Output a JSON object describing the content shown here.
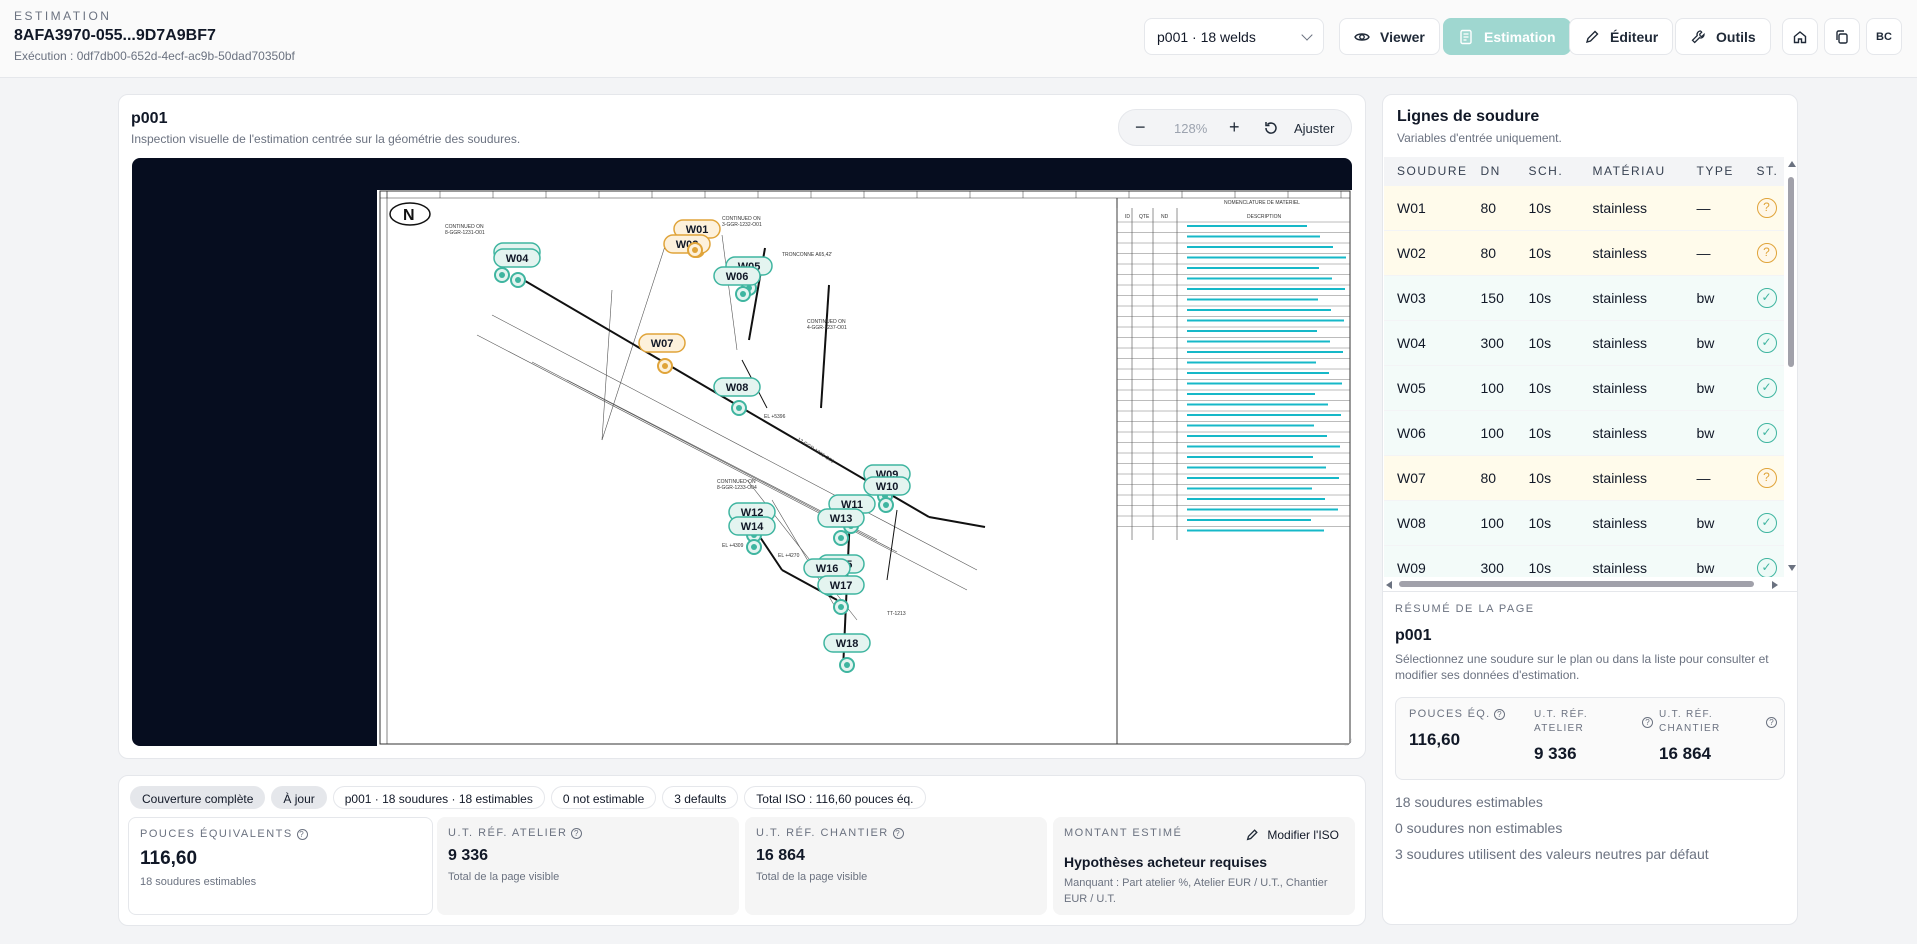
{
  "header": {
    "eyebrow": "ESTIMATION",
    "doc_id": "8AFA3970-055...9D7A9BF7",
    "execution": "Exécution : 0df7db00-652d-4ecf-ac9b-50dad70350bf",
    "page_select": "p001 · 18 welds",
    "viewer_label": "Viewer",
    "estimation_label": "Estimation",
    "editor_label": "Éditeur",
    "tools_label": "Outils",
    "avatar": "BC"
  },
  "canvas": {
    "title": "p001",
    "subtitle": "Inspection visuelle de l'estimation centrée sur la géométrie des soudures.",
    "zoom": "128%",
    "fit_label": "Ajuster",
    "zoom_out": "−",
    "zoom_in": "+"
  },
  "drawing": {
    "legend_title": "NOMENCLATURE DE MATERIEL",
    "col_id": "ID",
    "col_qty": "QTE",
    "col_nd": "ND",
    "col_desc": "DESCRIPTION",
    "north": "N",
    "notes": [
      "CONTINUED ON",
      "8-GGR-1231-O01",
      "CONTINUED ON",
      "3-GGR-1232-O01",
      "TRONCONNE A65,42'",
      "CONTINUED ON",
      "4-GGR-1237-O01",
      "CONTINUED ON",
      "8-GGR-1233-O04",
      "EL +5396",
      "EL +4270",
      "EL +4309",
      "12-GGR-1236-O01",
      "TT-1213"
    ],
    "welds": [
      {
        "id": "W01",
        "state": "warn"
      },
      {
        "id": "W02",
        "state": "warn"
      },
      {
        "id": "W03",
        "state": "ok"
      },
      {
        "id": "W04",
        "state": "ok"
      },
      {
        "id": "W05",
        "state": "ok"
      },
      {
        "id": "W06",
        "state": "ok"
      },
      {
        "id": "W07",
        "state": "warn"
      },
      {
        "id": "W08",
        "state": "ok"
      },
      {
        "id": "W09",
        "state": "ok"
      },
      {
        "id": "W10",
        "state": "ok"
      },
      {
        "id": "W11",
        "state": "ok"
      },
      {
        "id": "W12",
        "state": "ok"
      },
      {
        "id": "W13",
        "state": "ok"
      },
      {
        "id": "W14",
        "state": "ok"
      },
      {
        "id": "W15",
        "state": "ok"
      },
      {
        "id": "W16",
        "state": "ok"
      },
      {
        "id": "W17",
        "state": "ok"
      },
      {
        "id": "W18",
        "state": "ok"
      }
    ]
  },
  "chips": [
    "Couverture complète",
    "À jour",
    "p001 · 18 soudures · 18 estimables",
    "0 not estimable",
    "3 defaults",
    "Total ISO : 116,60 pouces éq."
  ],
  "stats": {
    "inches_label": "POUCES ÉQUIVALENTS",
    "inches_value": "116,60",
    "inches_sub": "18 soudures estimables",
    "ut_atelier_label": "U.T. RÉF. ATELIER",
    "ut_atelier_value": "9 336",
    "ut_atelier_sub": "Total de la page visible",
    "ut_chantier_label": "U.T. RÉF. CHANTIER",
    "ut_chantier_value": "16 864",
    "ut_chantier_sub": "Total de la page visible",
    "amount_label": "MONTANT ESTIMÉ",
    "amount_edit": "Modifier l'ISO",
    "amount_title": "Hypothèses acheteur requises",
    "amount_missing": "Manquant : Part atelier %, Atelier EUR / U.T., Chantier EUR / U.T."
  },
  "weld_list": {
    "title": "Lignes de soudure",
    "subtitle": "Variables d'entrée uniquement.",
    "columns": [
      "SOUDURE",
      "DN",
      "SCH.",
      "MATÉRIAU",
      "TYPE",
      "ST."
    ],
    "rows": [
      {
        "id": "W01",
        "dn": "80",
        "sch": "10s",
        "mat": "stainless",
        "type": "—",
        "status": "warn"
      },
      {
        "id": "W02",
        "dn": "80",
        "sch": "10s",
        "mat": "stainless",
        "type": "—",
        "status": "warn"
      },
      {
        "id": "W03",
        "dn": "150",
        "sch": "10s",
        "mat": "stainless",
        "type": "bw",
        "status": "ok"
      },
      {
        "id": "W04",
        "dn": "300",
        "sch": "10s",
        "mat": "stainless",
        "type": "bw",
        "status": "ok"
      },
      {
        "id": "W05",
        "dn": "100",
        "sch": "10s",
        "mat": "stainless",
        "type": "bw",
        "status": "ok"
      },
      {
        "id": "W06",
        "dn": "100",
        "sch": "10s",
        "mat": "stainless",
        "type": "bw",
        "status": "ok"
      },
      {
        "id": "W07",
        "dn": "80",
        "sch": "10s",
        "mat": "stainless",
        "type": "—",
        "status": "warn"
      },
      {
        "id": "W08",
        "dn": "100",
        "sch": "10s",
        "mat": "stainless",
        "type": "bw",
        "status": "ok"
      },
      {
        "id": "W09",
        "dn": "300",
        "sch": "10s",
        "mat": "stainless",
        "type": "bw",
        "status": "ok"
      }
    ]
  },
  "page_summary": {
    "eyebrow": "RÉSUMÉ DE LA PAGE",
    "title": "p001",
    "text": "Sélectionnez une soudure sur le plan ou dans la liste pour consulter et modifier ses données d'estimation.",
    "inches_label": "POUCES ÉQ.",
    "inches_value": "116,60",
    "atelier_label": "U.T. RÉF. ATELIER",
    "atelier_value": "9 336",
    "chantier_label": "U.T. RÉF. CHANTIER",
    "chantier_value": "16 864",
    "line1": "18 soudures estimables",
    "line2": "0 soudures non estimables",
    "line3": "3 soudures utilisent des valeurs neutres par défaut"
  },
  "colors": {
    "accent": "#9fd7d0",
    "ok": "#3fb5a0",
    "warn": "#e0a43a",
    "viewer_bg": "#060d1f",
    "legend_text": "#16b8c8"
  }
}
